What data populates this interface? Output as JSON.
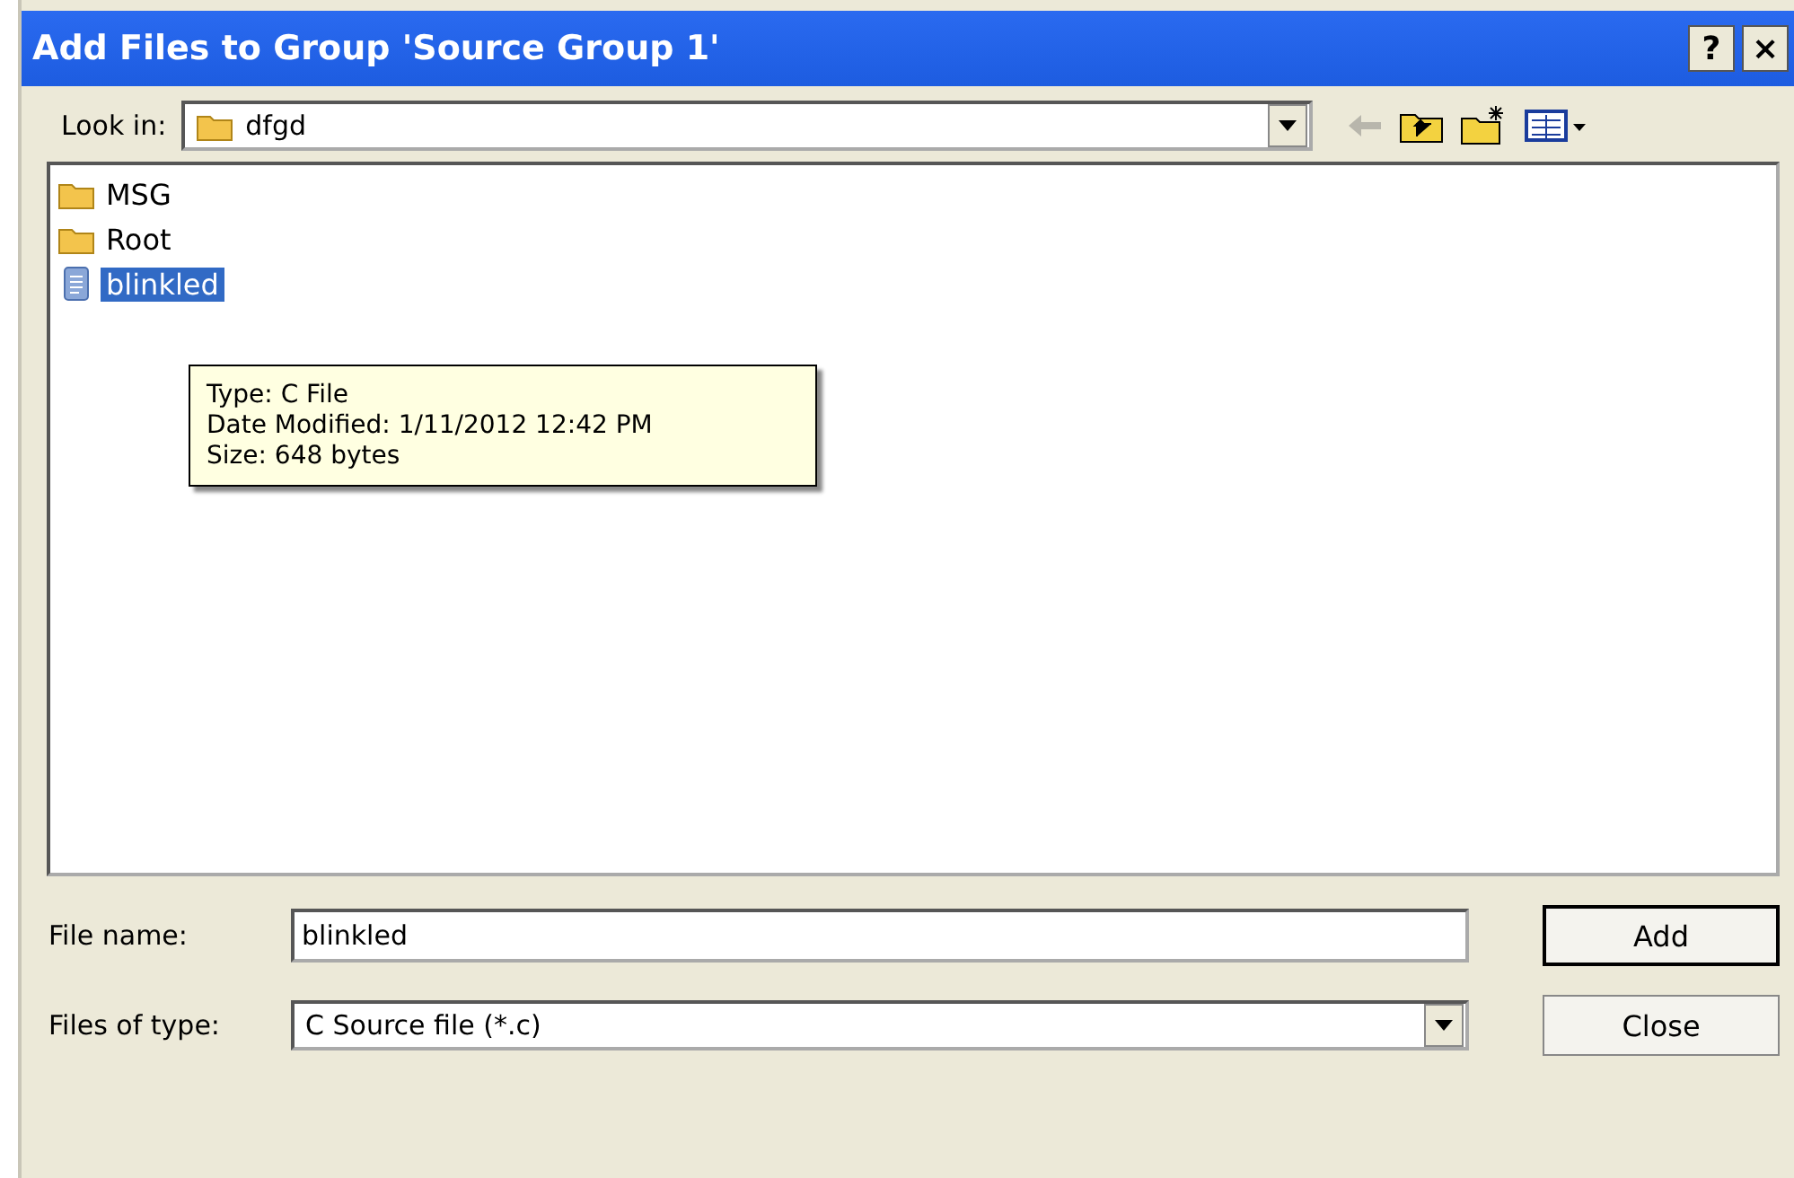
{
  "window": {
    "title": "Add Files to Group 'Source Group 1'",
    "help_button": "?",
    "close_button": "×"
  },
  "look_in": {
    "label": "Look in:",
    "value": "dfgd"
  },
  "files": [
    {
      "name": "MSG",
      "kind": "folder",
      "selected": false
    },
    {
      "name": "Root",
      "kind": "folder",
      "selected": false
    },
    {
      "name": "blinkled",
      "kind": "file",
      "selected": true
    }
  ],
  "tooltip": {
    "lines": [
      "Type: C File",
      "Date Modified: 1/11/2012 12:42 PM",
      "Size: 648 bytes"
    ]
  },
  "file_name": {
    "label": "File name:",
    "value": "blinkled"
  },
  "file_type": {
    "label": "Files of type:",
    "value": "C Source file (*.c)"
  },
  "buttons": [
    {
      "label": "Add",
      "default": true
    },
    {
      "label": "Close",
      "default": false
    }
  ]
}
